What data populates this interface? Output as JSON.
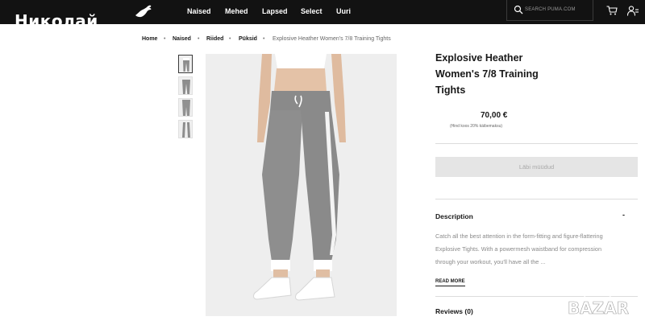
{
  "overlay": {
    "name": "Николай"
  },
  "nav": {
    "items": [
      "Naised",
      "Mehed",
      "Lapsed",
      "Select",
      "Uuri"
    ],
    "search_placeholder": "SEARCH PUMA.COM"
  },
  "breadcrumb": [
    "Home",
    "Naised",
    "Riided",
    "Püksid",
    "Explosive Heather Women's 7/8 Training Tights"
  ],
  "product": {
    "title": "Explosive Heather Women's 7/8 Training Tights",
    "price": "70,00 €",
    "vat_note": "(Hind koos 20% käibemaksu)",
    "button_label": "Läbi müüdud",
    "description_heading": "Description",
    "description_toggle": "-",
    "description_text": "Catch all the best attention in the form-fitting and figure-flattering Explosive Tights. With a powermesh waistband for compression through your workout, you'll have all the ...",
    "read_more": "READ MORE",
    "reviews": "Reviews (0)"
  },
  "watermark": {
    "text": "BAZAR"
  },
  "colors": {
    "topbar": "#121212",
    "sold_button": "#e5e5e5",
    "text": "#181818",
    "muted": "#8a8a8a"
  },
  "icons": [
    "puma-logo-icon",
    "search-icon",
    "cart-icon",
    "account-icon"
  ]
}
